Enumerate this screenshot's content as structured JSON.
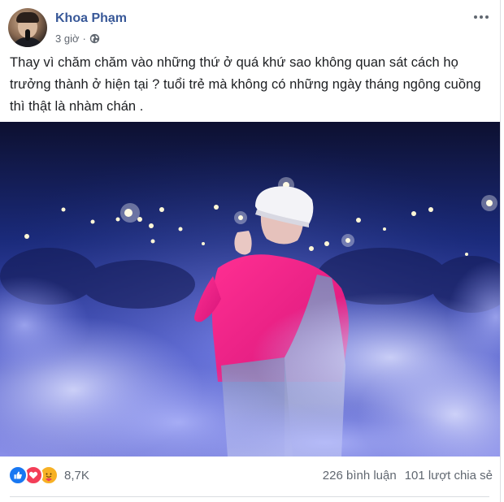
{
  "post": {
    "author": "Khoa Phạm",
    "time": "3 giờ",
    "privacy_icon": "globe-icon",
    "caption_line1": "Thay vì chăm chăm vào những thứ ở quá khứ sao không quan sát cách họ",
    "caption_line2": "trưởng thành ở hiện tại ? tuổi trẻ mà không có những ngày tháng ngông cuồng",
    "caption_line3": "thì thật là nhàm chán .",
    "photo_icon": "concert-photo"
  },
  "reactions": {
    "icons": [
      "like-icon",
      "love-icon",
      "care-icon"
    ],
    "count": "8,7K"
  },
  "stats": {
    "comments": "226 bình luận",
    "shares": "101 lượt chia sẻ"
  },
  "colors": {
    "author_link": "#385898",
    "like": "#1877f2",
    "love": "#f33e58",
    "care": "#f7b125",
    "secondary_text": "#606770"
  }
}
